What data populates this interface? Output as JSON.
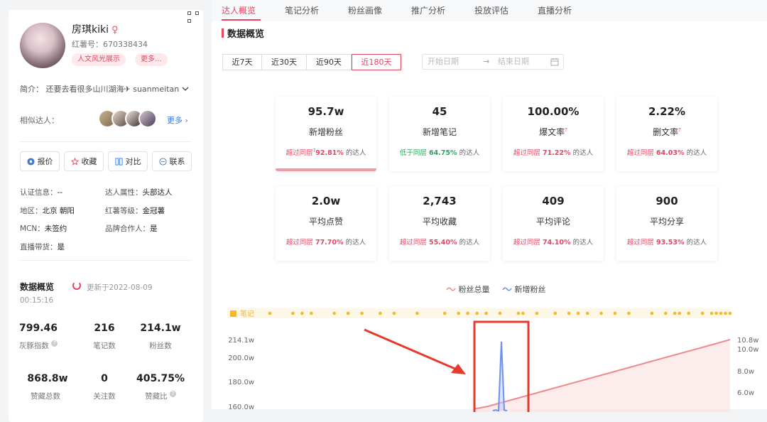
{
  "profile": {
    "name": "房琪kiki",
    "gender_symbol": "♀",
    "red_id": "红薯号：670338434",
    "tags": [
      "人文风光展示",
      "更多..."
    ],
    "intro": "简介：  还要去看很多山川湖海✈ suanmeitan"
  },
  "similar": {
    "label": "相似达人：",
    "more": "更多"
  },
  "actions": [
    "报价",
    "收藏",
    "对比",
    "联系"
  ],
  "info": {
    "auth_label": "认证信息：",
    "auth_value": "--",
    "attr_label": "达人属性：",
    "attr_value": "头部达人",
    "region_label": "地区：",
    "region_value": "北京 朝阳",
    "level_label": "红薯等级：",
    "level_value": "金冠薯",
    "mcn_label": "MCN：",
    "mcn_value": "未签约",
    "brand_label": "品牌合作人：",
    "brand_value": "是",
    "live_label": "直播带货：",
    "live_value": "是"
  },
  "overview": {
    "title": "数据概览",
    "updated": "更新于2022-08-09",
    "updated_time": "00:15:16",
    "stats": [
      {
        "value": "799.46",
        "label": "灰豚指数"
      },
      {
        "value": "216",
        "label": "笔记数"
      },
      {
        "value": "214.1w",
        "label": "粉丝数"
      },
      {
        "value": "868.8w",
        "label": "赞藏总数"
      },
      {
        "value": "0",
        "label": "关注数"
      },
      {
        "value": "405.75%",
        "label": "赞藏比"
      }
    ]
  },
  "tabs": [
    "达人概览",
    "笔记分析",
    "粉丝画像",
    "推广分析",
    "投放评估",
    "直播分析"
  ],
  "section_title": "数据概览",
  "ranges": [
    "近7天",
    "近30天",
    "近90天",
    "近180天"
  ],
  "date_range": {
    "start": "开始日期",
    "end": "结束日期",
    "arrow": "→"
  },
  "cards": [
    {
      "value": "95.7w",
      "label": "新增粉丝",
      "rel": "超过同层",
      "pct": "92.81%",
      "suffix": "的达人"
    },
    {
      "value": "45",
      "label": "新增笔记",
      "rel": "低于同层",
      "pct": "64.75%",
      "suffix": "的达人"
    },
    {
      "value": "100.00%",
      "label": "爆文率",
      "rel": "超过同层",
      "pct": "71.22%",
      "suffix": "的达人"
    },
    {
      "value": "2.22%",
      "label": "删文率",
      "rel": "超过同层",
      "pct": "64.03%",
      "suffix": "的达人"
    },
    {
      "value": "2.0w",
      "label": "平均点赞",
      "rel": "超过同层",
      "pct": "77.70%",
      "suffix": "的达人"
    },
    {
      "value": "2,743",
      "label": "平均收藏",
      "rel": "超过同层",
      "pct": "55.40%",
      "suffix": "的达人"
    },
    {
      "value": "409",
      "label": "平均评论",
      "rel": "超过同层",
      "pct": "74.10%",
      "suffix": "的达人"
    },
    {
      "value": "900",
      "label": "平均分享",
      "rel": "超过同层",
      "pct": "93.53%",
      "suffix": "的达人"
    }
  ],
  "colors": {
    "accent": "#e8455f",
    "total_line": "#f08a8a",
    "new_line": "#6f92f0",
    "note_dot": "#f5b82e",
    "annotation": "#e53b2c"
  },
  "chart_data": {
    "type": "line",
    "legend": [
      "粉丝总量",
      "新增粉丝"
    ],
    "note_label": "笔记",
    "y_left_ticks": [
      "214.1w",
      "200.0w",
      "180.0w",
      "160.0w"
    ],
    "y_right_ticks": [
      "10.8w",
      "10.0w",
      "8.0w",
      "6.0w"
    ],
    "series": [
      {
        "name": "粉丝总量",
        "values": [
          158,
          160,
          163,
          166,
          169,
          172,
          175,
          178,
          181,
          184,
          187,
          190,
          193,
          196,
          199,
          202,
          205,
          208,
          211,
          214.1
        ]
      },
      {
        "name": "新增粉丝",
        "values": [
          0.2,
          0.3,
          0.2,
          10.5,
          0.3,
          0.2
        ]
      }
    ],
    "note_positions": [
      0.0,
      0.05,
      0.07,
      0.09,
      0.14,
      0.17,
      0.2,
      0.24,
      0.27,
      0.32,
      0.38,
      0.41,
      0.43,
      0.45,
      0.47,
      0.5,
      0.54,
      0.55,
      0.58,
      0.62,
      0.65,
      0.67,
      0.69,
      0.72,
      0.75,
      0.78,
      0.83,
      0.86,
      0.88,
      0.89,
      0.91,
      0.94,
      0.96,
      0.97,
      0.98,
      0.99,
      1.0
    ]
  }
}
